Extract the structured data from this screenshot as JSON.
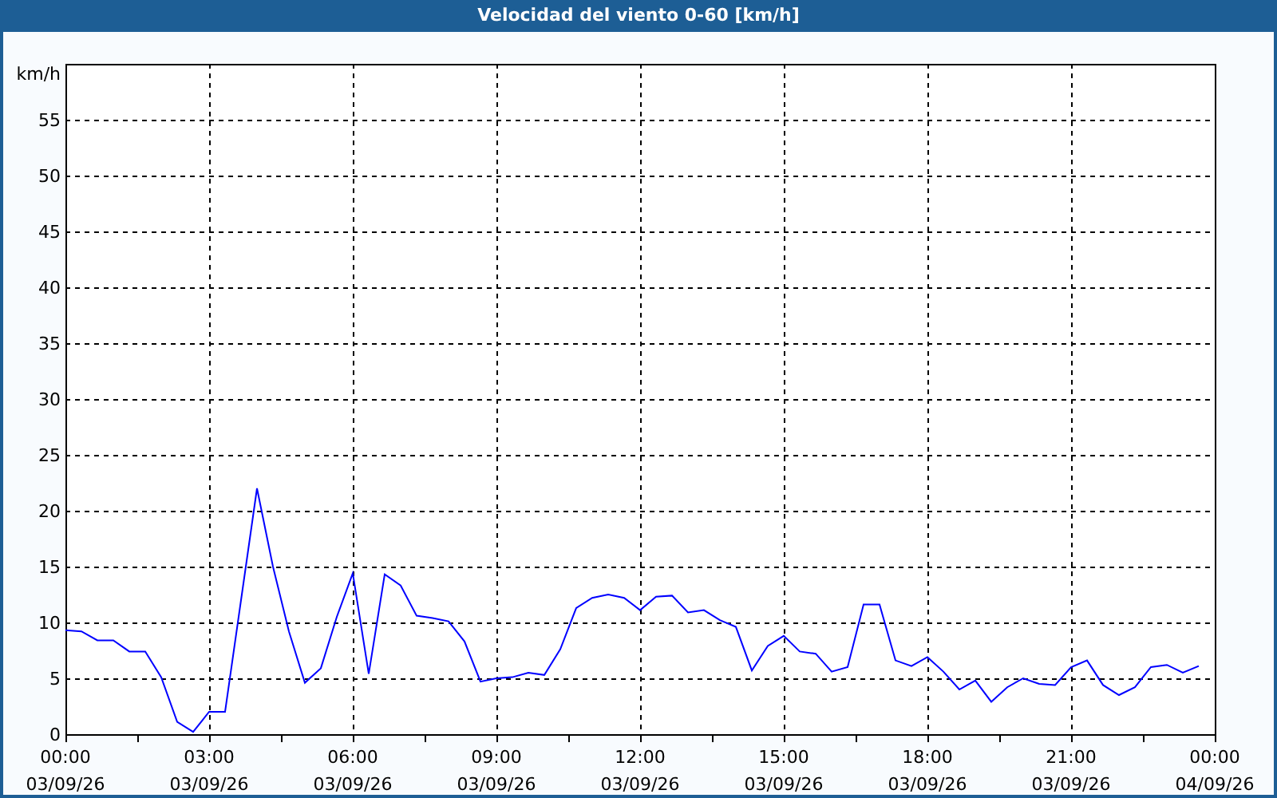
{
  "chart_data": {
    "type": "line",
    "title": "Velocidad del viento 0-60 [km/h]",
    "ylabel": "km/h",
    "categories": [
      "00:00\n03/09/26",
      null,
      null,
      null,
      null,
      null,
      null,
      null,
      null,
      "03:00\n03/09/26",
      null,
      null,
      null,
      null,
      null,
      null,
      null,
      null,
      "06:00\n03/09/26",
      null,
      null,
      null,
      null,
      null,
      null,
      null,
      null,
      "09:00\n03/09/26",
      null,
      null,
      null,
      null,
      null,
      null,
      null,
      null,
      "12:00\n03/09/26",
      null,
      null,
      null,
      null,
      null,
      null,
      null,
      null,
      "15:00\n03/09/26",
      null,
      null,
      null,
      null,
      null,
      null,
      null,
      null,
      "18:00\n03/09/26",
      null,
      null,
      null,
      null,
      null,
      null,
      null,
      null,
      "21:00\n03/09/26",
      null,
      null,
      null,
      null,
      null,
      null,
      null,
      null,
      "00:00\n04/09/26"
    ],
    "series": [
      {
        "color": "#0000ff",
        "values": [
          9.3,
          9.2,
          8.4,
          8.4,
          7.4,
          7.4,
          5.1,
          1.1,
          0.2,
          2.0,
          2.0,
          12,
          22.0,
          15.0,
          9.2,
          4.6,
          5.9,
          10.5,
          14.4,
          5.4,
          14.3,
          13.3,
          10.6,
          10.4,
          10.1,
          8.3,
          4.7,
          5.0,
          5.1,
          5.5,
          5.3,
          7.6,
          11.3,
          12.2,
          12.5,
          12.2,
          11.1,
          12.3,
          12.4,
          10.9,
          11.1,
          10.2,
          9.6,
          5.7,
          7.9,
          8.8,
          7.4,
          7.2,
          5.6,
          6.0,
          11.6,
          11.6,
          6.6,
          6.1,
          6.9,
          5.6,
          4.0,
          4.8,
          2.9,
          4.2,
          5.0,
          4.5,
          4.4,
          6.0,
          6.6,
          4.4,
          3.5,
          4.2,
          6.0,
          6.2,
          5.5,
          6.1,
          null
        ]
      }
    ],
    "ylim": [
      0,
      60
    ],
    "grid": true,
    "yticks": [
      0,
      5,
      10,
      15,
      20,
      25,
      30,
      35,
      40,
      45,
      50,
      55
    ]
  }
}
